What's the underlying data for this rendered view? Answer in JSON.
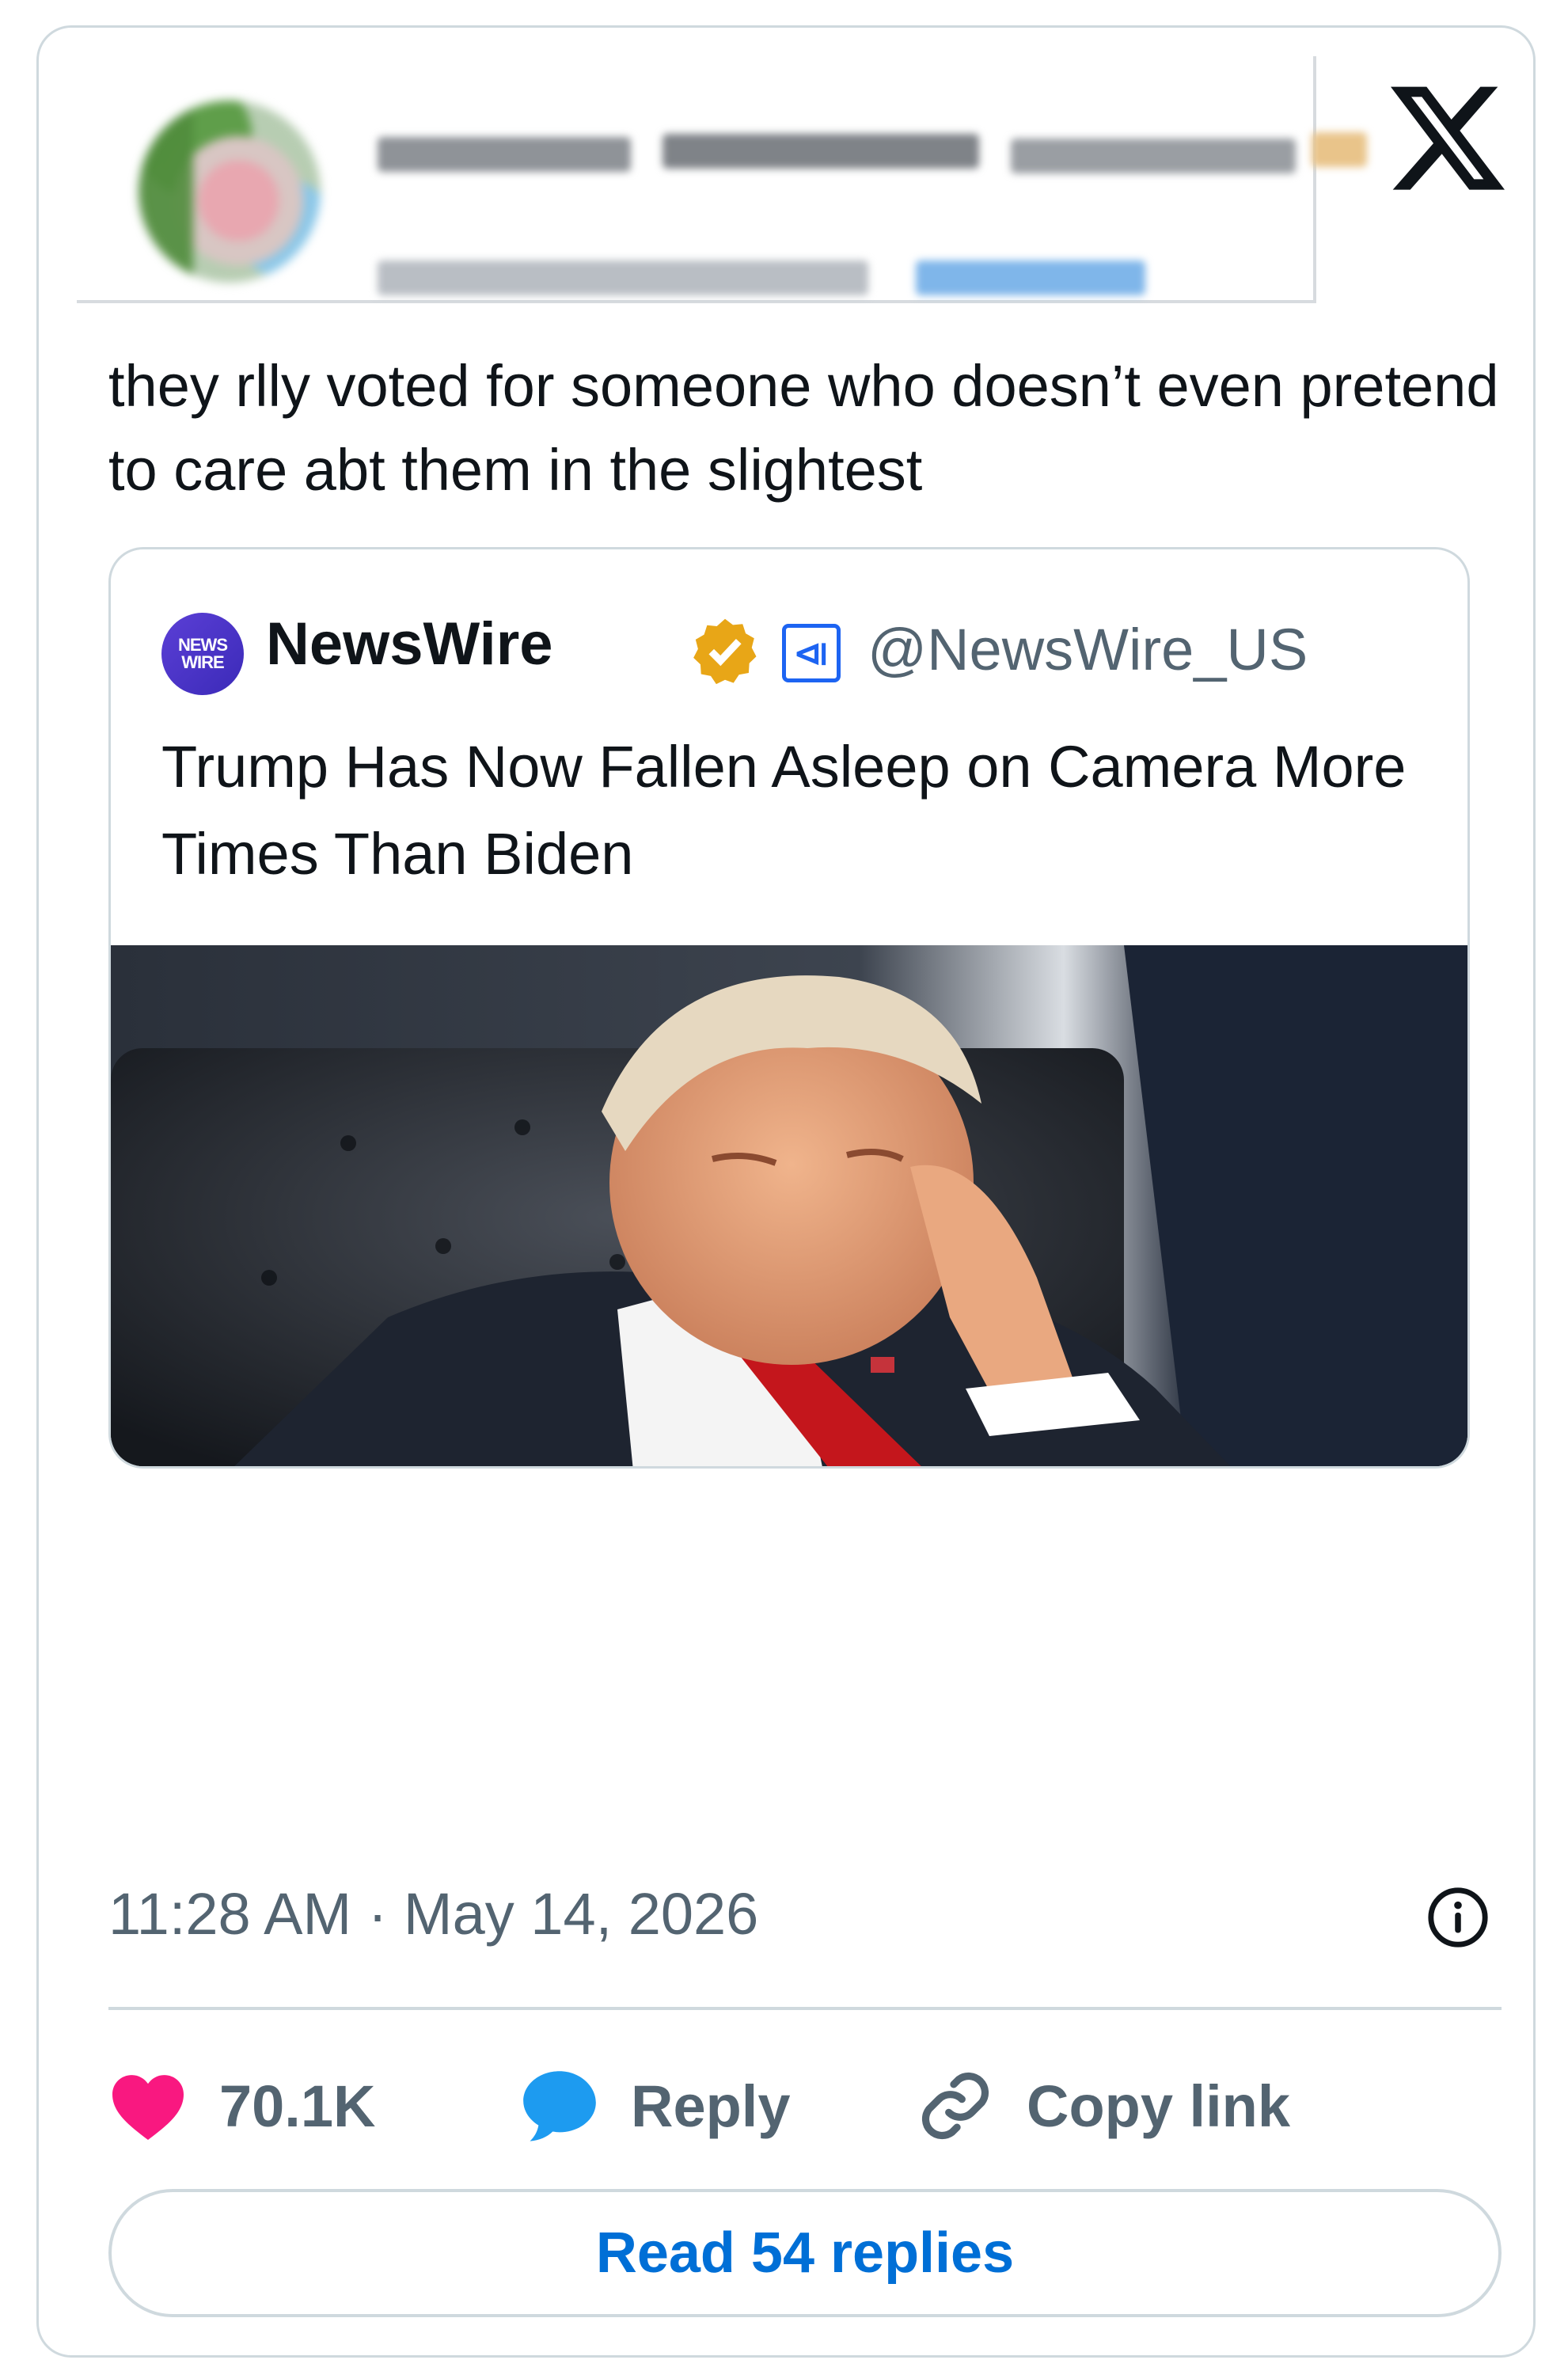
{
  "platform": "X",
  "tweet": {
    "text": "they rlly voted for someone who doesn’t even pretend to care abt them in the slightest",
    "timestamp": "11:28 AM · May 14, 2026"
  },
  "quoted": {
    "avatar_text": [
      "NEWS",
      "WIRE"
    ],
    "name": "NewsWire",
    "handle": "@NewsWire_US",
    "title": "Trump Has Now Fallen Asleep on Camera More Times Than Biden",
    "photo_label": "Photo of Trump with eyes closed, head resting on hand in a leather chair"
  },
  "actions": {
    "likes": "70.1K",
    "reply": "Reply",
    "copy_link": "Copy link"
  },
  "read_replies": "Read 54 replies",
  "colors": {
    "like": "#f91880",
    "reply": "#1d9bf0",
    "link": "#006fd6",
    "verified": "#e8a617"
  }
}
